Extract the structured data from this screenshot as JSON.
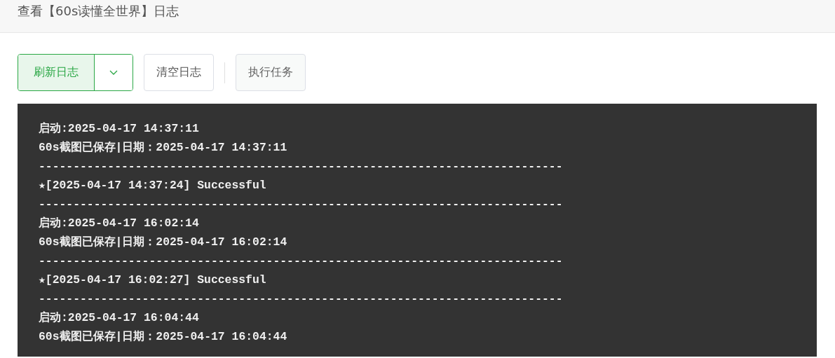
{
  "header": {
    "title": "查看【60s读懂全世界】日志"
  },
  "toolbar": [
    {
      "kind": "split",
      "label": "刷新日志"
    },
    {
      "kind": "plain",
      "label": "清空日志"
    },
    {
      "kind": "divider"
    },
    {
      "kind": "soft",
      "label": "执行任务"
    }
  ],
  "log": {
    "lines": [
      "启动:2025-04-17 14:37:11",
      "60s截图已保存|日期：2025-04-17 14:37:11",
      "----------------------------------------------------------------------------",
      "★[2025-04-17 14:37:24] Successful",
      "----------------------------------------------------------------------------",
      "启动:2025-04-17 16:02:14",
      "60s截图已保存|日期：2025-04-17 16:02:14",
      "----------------------------------------------------------------------------",
      "★[2025-04-17 16:02:27] Successful",
      "----------------------------------------------------------------------------",
      "启动:2025-04-17 16:04:44",
      "60s截图已保存|日期：2025-04-17 16:04:44"
    ]
  }
}
